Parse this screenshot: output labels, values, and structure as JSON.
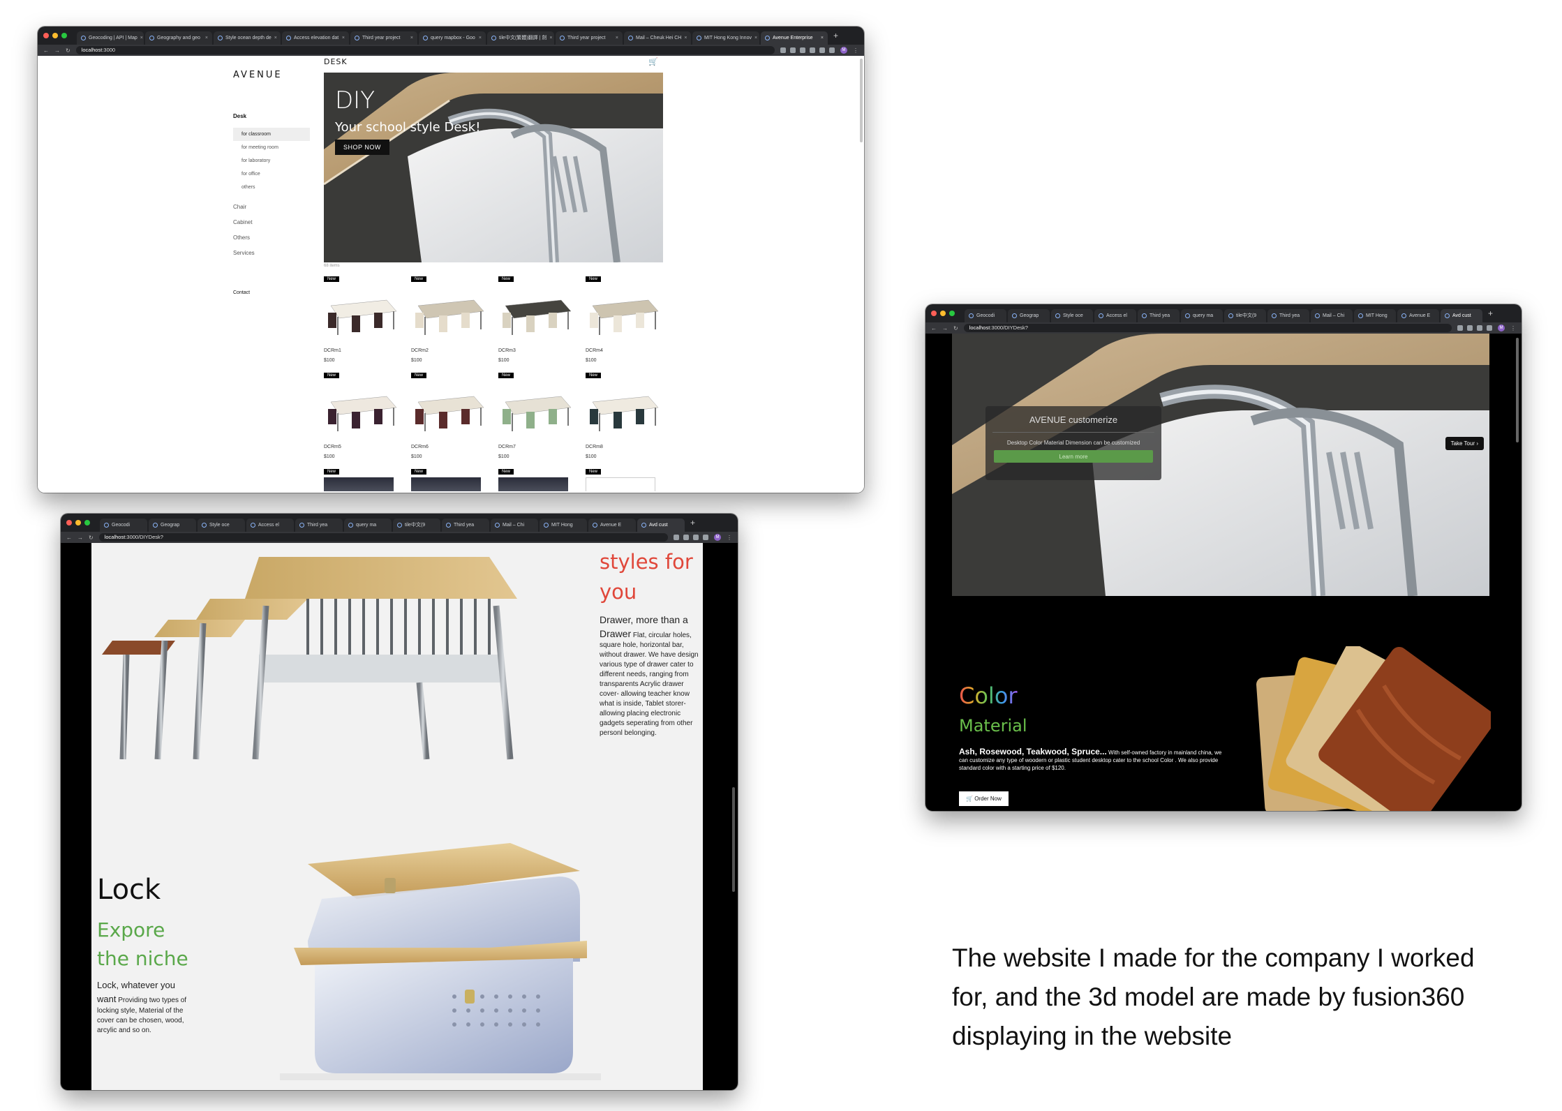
{
  "caption": "The website I made for the company I worked for, and the 3d model are made by fusion360 displaying in the website",
  "browser_a": {
    "tabs": [
      "Geocoding | API | Map",
      "Geography and geo",
      "Style ocean depth de",
      "Access elevation dat",
      "Third year project",
      "query mapbox - Goo",
      "tile中文(繁體)翻譯 | 劍",
      "Third year project",
      "Mail – Cheuk Hei CH",
      "MIT Hong Kong Innov",
      "Avenue Enterprise"
    ],
    "url_host": "localhost",
    "url_path": ":3000",
    "avatar": "M"
  },
  "browser_b": {
    "tabs": [
      "Geocodi",
      "Geograp",
      "Style oce",
      "Access el",
      "Third yea",
      "query ma",
      "tile中文(9",
      "Third yea",
      "Mail – Chi",
      "MIT Hong",
      "Avenue E",
      "Avd cust"
    ],
    "url_host": "localhost",
    "url_path": ":3000/DIYDesk?",
    "avatar": "M"
  },
  "browser_c": {
    "tabs": [
      "Geocodi",
      "Geograp",
      "Style oce",
      "Access el",
      "Third yea",
      "query ma",
      "tile中文(9",
      "Third yea",
      "Mail – Chi",
      "MIT Hong",
      "Avenue E",
      "Avd cust"
    ],
    "url_host": "localhost",
    "url_path": ":3000/DIYDesk?",
    "avatar": "M"
  },
  "shop": {
    "brand": "AVENUE",
    "breadcrumb": "DESK",
    "sidebar": {
      "heading": "Desk",
      "subitems": [
        "for classroom",
        "for meeting room",
        "for laboratory",
        "for office",
        "others"
      ],
      "items": [
        "Chair",
        "Cabinet",
        "Others",
        "Services"
      ],
      "contact": "Contact"
    },
    "hero": {
      "title": "DIY",
      "subtitle": "Your school style Desk!",
      "button": "SHOP NOW"
    },
    "count": "68 items",
    "badge": "New",
    "products": [
      {
        "name": "DCRm1",
        "price": "$100"
      },
      {
        "name": "DCRm2",
        "price": "$100"
      },
      {
        "name": "DCRm3",
        "price": "$100"
      },
      {
        "name": "DCRm4",
        "price": "$100"
      },
      {
        "name": "DCRm5",
        "price": "$100"
      },
      {
        "name": "DCRm6",
        "price": "$100"
      },
      {
        "name": "DCRm7",
        "price": "$100"
      },
      {
        "name": "DCRm8",
        "price": "$100"
      }
    ]
  },
  "diy": {
    "styles_title": "styles for you",
    "styles_lead": "Drawer, more than a Drawer",
    "styles_body": "Flat, circular holes, square hole, horizontal bar, without drawer. We have design various type of drawer cater to different needs, ranging from transparents Acrylic drawer cover- allowing teacher know what is inside, Tablet storer- allowing placing electronic gadgets seperating from other personl belonging.",
    "lock_title": "Lock",
    "lock_sub": "Expore the niche",
    "lock_lead": "Lock, whatever you want",
    "lock_body": "Providing two types of locking style, Material of the cover can be chosen, wood, arcylic and so on."
  },
  "customize": {
    "panel_title": "AVENUE customerize",
    "panel_text": "Desktop Color Material Dimension can be customized",
    "learn": "Learn more",
    "tour": "Take Tour ›",
    "color_title": "Color",
    "material_title": "Material",
    "material_lead": "Ash, Rosewood, Teakwood, Spruce...",
    "material_body": "With self-owned factory in mainland china, we can customize any type of woodern or plastic student desktop cater to the school Color . We also provide standard color with a starting price of $120.",
    "order": "Order Now",
    "cart_icon": "cart-icon"
  }
}
